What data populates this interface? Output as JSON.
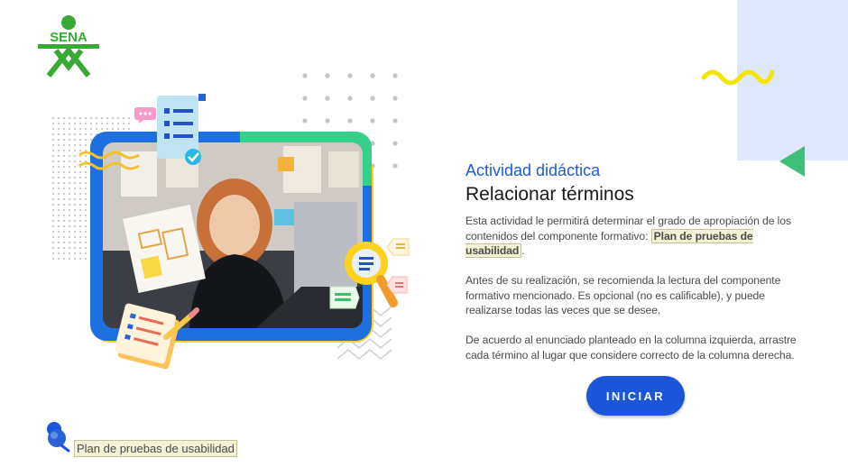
{
  "brand": {
    "logo_text": "SENA",
    "logo_color": "#39a935"
  },
  "activity": {
    "eyebrow": "Actividad didáctica",
    "title": "Relacionar términos",
    "p1_before": "Esta actividad le permitirá determinar el grado de apropiación de los contenidos del componente formativo: ",
    "p1_highlight": "Plan de pruebas de usabilidad",
    "p1_after": ".",
    "p2": "Antes de su realización, se recomienda la lectura del componente formativo mencionado.  Es opcional (no es calificable), y puede realizarse todas las veces que se desee.",
    "p3": "De acuerdo al enunciado planteado en la columna izquierda, arrastre cada término al lugar que considere correcto de la columna derecha.",
    "start_label": "INICIAR"
  },
  "footer": {
    "pin_icon": "pushpin-icon",
    "label": "Plan de pruebas de usabilidad"
  },
  "colors": {
    "accent_blue": "#1c55d8",
    "green": "#35d08a",
    "yellow": "#ffd21f",
    "panel": "#dfe8fb"
  }
}
